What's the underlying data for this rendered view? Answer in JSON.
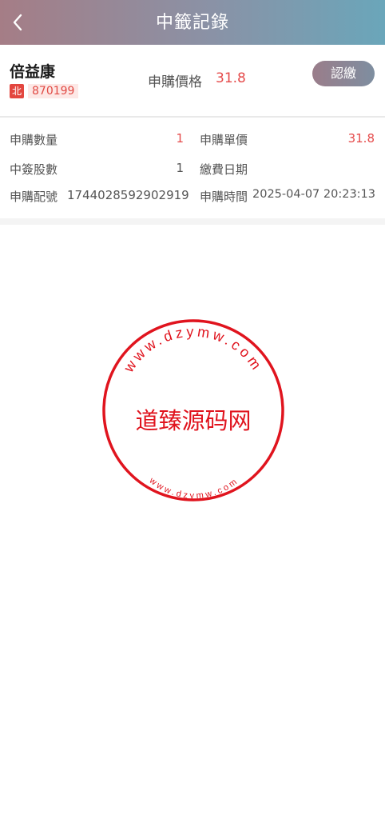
{
  "header": {
    "title": "中籤記錄",
    "back_icon": "chevron-left-icon"
  },
  "stock": {
    "name": "倍益康",
    "market_tag": "北",
    "code": "870199",
    "price_label": "申購價格",
    "price_value": "31.8",
    "pay_button": "認繳"
  },
  "details": {
    "qty_label": "申購數量",
    "qty_value": "1",
    "unit_price_label": "申購單價",
    "unit_price_value": "31.8",
    "won_label": "中簽股數",
    "won_value": "1",
    "pay_date_label": "繳費日期",
    "pay_date_value": "",
    "alloc_label": "申購配號",
    "alloc_value": "1744028592902919",
    "time_label": "申購時間",
    "time_value": "2025-04-07 20:23:13"
  },
  "watermark": {
    "center_text": "道臻源码网",
    "top_arc_text": "www.dzymw.com",
    "bottom_arc_text": "www.dzymw.com",
    "color": "#e0141e"
  },
  "colors": {
    "accent_red": "#e54b4b",
    "header_start": "#a57d86",
    "header_end": "#6aa6ba"
  }
}
